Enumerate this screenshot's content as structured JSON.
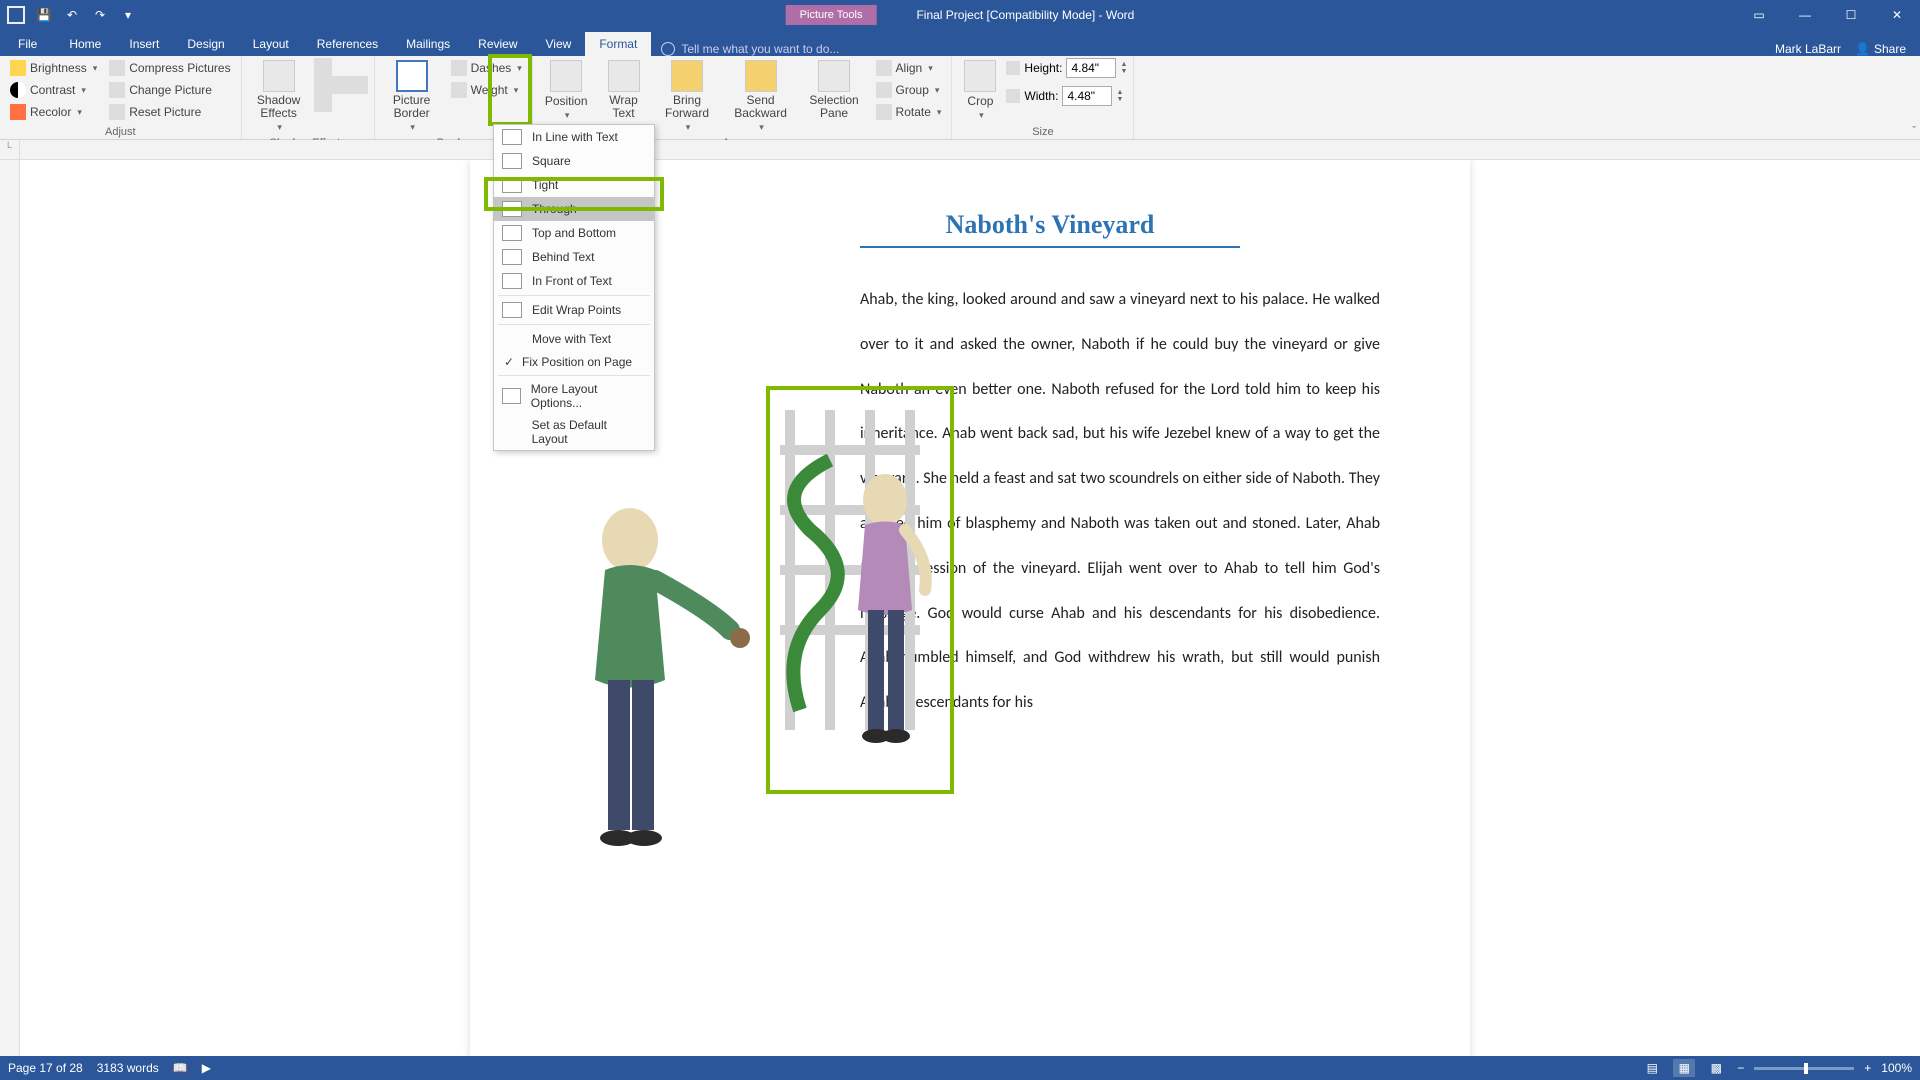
{
  "titlebar": {
    "picture_tools": "Picture Tools",
    "doc_title": "Final Project [Compatibility Mode] - Word"
  },
  "tabs": {
    "file": "File",
    "home": "Home",
    "insert": "Insert",
    "design": "Design",
    "layout": "Layout",
    "references": "References",
    "mailings": "Mailings",
    "review": "Review",
    "view": "View",
    "format": "Format",
    "tellme_placeholder": "Tell me what you want to do...",
    "user": "Mark LaBarr",
    "share": "Share"
  },
  "ribbon": {
    "adjust": {
      "brightness": "Brightness",
      "contrast": "Contrast",
      "recolor": "Recolor",
      "compress": "Compress Pictures",
      "change": "Change Picture",
      "reset": "Reset Picture",
      "label": "Adjust"
    },
    "shadow": {
      "btn": "Shadow Effects",
      "label": "Shadow Effects"
    },
    "border": {
      "btn": "Picture Border",
      "dashes": "Dashes",
      "weight": "Weight",
      "label": "Border"
    },
    "arrange": {
      "position": "Position",
      "wrap": "Wrap Text",
      "bring": "Bring Forward",
      "send": "Send Backward",
      "selection": "Selection Pane",
      "align": "Align",
      "group": "Group",
      "rotate": "Rotate",
      "label": "Arrange"
    },
    "size": {
      "crop": "Crop",
      "height_label": "Height:",
      "height_val": "4.84\"",
      "width_label": "Width:",
      "width_val": "4.48\"",
      "label": "Size"
    }
  },
  "wrap_menu": {
    "inline": "In Line with Text",
    "square": "Square",
    "tight": "Tight",
    "through": "Through",
    "topbottom": "Top and Bottom",
    "behind": "Behind Text",
    "infront": "In Front of Text",
    "editpoints": "Edit Wrap Points",
    "movewith": "Move with Text",
    "fixpos": "Fix Position on Page",
    "more": "More Layout Options...",
    "setdefault": "Set as Default Layout"
  },
  "document": {
    "heading": "Naboth's Vineyard",
    "body": "Ahab, the king, looked around and saw a vineyard next to his palace. He walked over to it and asked the owner, Naboth if he could buy the vineyard or give Naboth an even better one. Naboth refused for the Lord told him to keep his inheritance. Ahab went back sad, but his wife Jezebel knew of a way to get the vineyard. She held a feast and sat two scoundrels on either side of Naboth. They accused him of blasphemy and Naboth was taken out and stoned. Later, Ahab took possession of the vineyard. Elijah went over to Ahab to tell him God's message. God would curse Ahab and his descendants for his disobedience. Ahab humbled himself, and God withdrew his wrath, but still would punish Ahab's descendants for his"
  },
  "statusbar": {
    "page": "Page 17 of 28",
    "words": "3183 words",
    "zoom": "100%"
  }
}
